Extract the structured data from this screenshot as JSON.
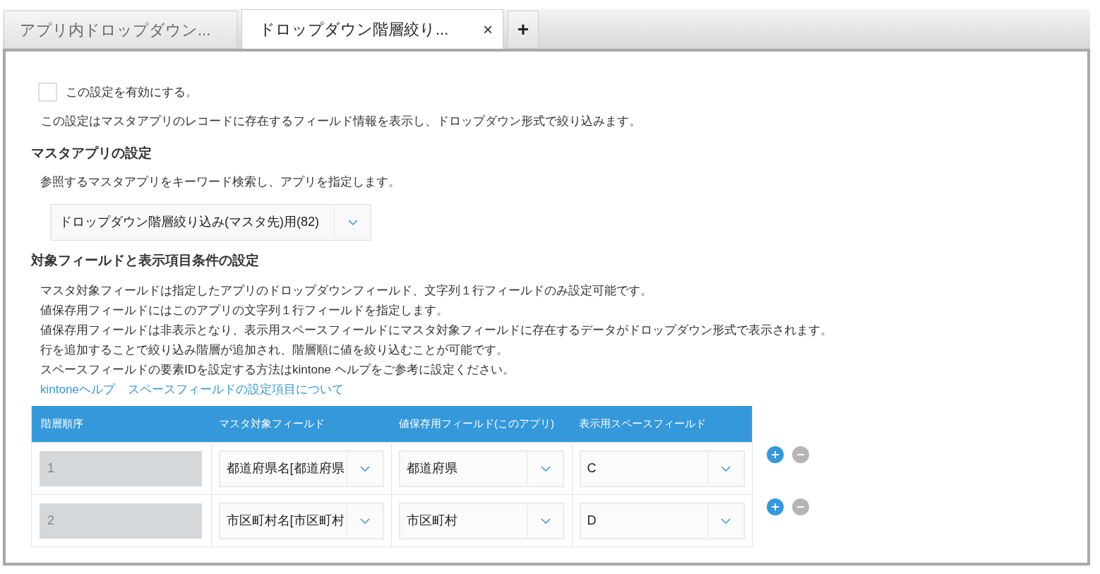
{
  "tabs": [
    {
      "label": "アプリ内ドロップダウン...",
      "selected": false,
      "closable": false
    },
    {
      "label": "ドロップダウン階層絞り...",
      "selected": true,
      "closable": true
    }
  ],
  "add_tab": "+",
  "close_tab": "×",
  "enable": {
    "label": "この設定を有効にする。",
    "checked": false
  },
  "intro": "この設定はマスタアプリのレコードに存在するフィールド情報を表示し、ドロップダウン形式で絞り込みます。",
  "master_section": {
    "heading": "マスタアプリの設定",
    "description": "参照するマスタアプリをキーワード検索し、アプリを指定します。",
    "app_select": "ドロップダウン階層絞り込み(マスタ先)用(82)"
  },
  "field_section": {
    "heading": "対象フィールドと表示項目条件の設定",
    "notes": [
      "マスタ対象フィールドは指定したアプリのドロップダウンフィールド、文字列１行フィールドのみ設定可能です。",
      "値保存用フィールドにはこのアプリの文字列１行フィールドを指定します。",
      "値保存用フィールドは非表示となり、表示用スペースフィールドにマスタ対象フィールドに存在するデータがドロップダウン形式で表示されます。",
      "行を追加することで絞り込み階層が追加され、階層順に値を絞り込むことが可能です。",
      "スペースフィールドの要素IDを設定する方法はkintone ヘルプをご参考に設定ください。"
    ],
    "links": [
      "kintoneヘルプ",
      "スペースフィールドの設定項目について"
    ]
  },
  "table": {
    "columns": [
      "階層順序",
      "マスタ対象フィールド",
      "値保存用フィールド(このアプリ)",
      "表示用スペースフィールド"
    ],
    "rows": [
      {
        "order": "1",
        "master_field": "都道府県名[都道府県",
        "store_field": "都道府県",
        "space_field": "C",
        "removable": false
      },
      {
        "order": "2",
        "master_field": "市区町村名[市区町村",
        "store_field": "市区町村",
        "space_field": "D",
        "removable": false
      }
    ]
  }
}
